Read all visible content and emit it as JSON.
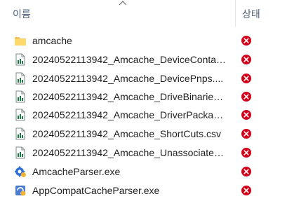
{
  "header": {
    "name_label": "이름",
    "status_label": "상태"
  },
  "status_colors": {
    "error": "#d0021b"
  },
  "files": [
    {
      "name": "amcache",
      "icon": "folder-icon",
      "status": "error-icon"
    },
    {
      "name": "20240522113942_Amcache_DeviceConta…",
      "icon": "csv-file-icon",
      "status": "error-icon"
    },
    {
      "name": "20240522113942_Amcache_DevicePnps....",
      "icon": "csv-file-icon",
      "status": "error-icon"
    },
    {
      "name": "20240522113942_Amcache_DriveBinarie…",
      "icon": "csv-file-icon",
      "status": "error-icon"
    },
    {
      "name": "20240522113942_Amcache_DriverPacka…",
      "icon": "csv-file-icon",
      "status": "error-icon"
    },
    {
      "name": "20240522113942_Amcache_ShortCuts.csv",
      "icon": "csv-file-icon",
      "status": "error-icon"
    },
    {
      "name": "20240522113942_Amcache_Unassociate…",
      "icon": "csv-file-icon",
      "status": "error-icon"
    },
    {
      "name": "AmcacheParser.exe",
      "icon": "exe-app-icon",
      "status": "error-icon"
    },
    {
      "name": "AppCompatCacheParser.exe",
      "icon": "exe-app-icon",
      "status": "error-icon"
    }
  ]
}
